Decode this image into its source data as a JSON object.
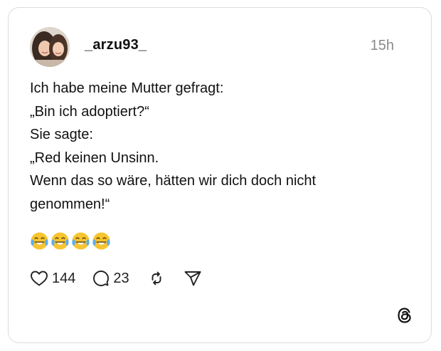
{
  "post": {
    "username": "_arzu93_",
    "timestamp": "15h",
    "text_lines": [
      "Ich habe meine Mutter gefragt:",
      "„Bin ich adoptiert?“",
      "Sie sagte:",
      "„Red keinen Unsinn.",
      "Wenn das so wäre, hätten wir dich doch nicht",
      "genommen!“"
    ],
    "emojis": [
      "face-with-tears-of-joy",
      "face-with-tears-of-joy",
      "face-with-tears-of-joy",
      "face-with-tears-of-joy"
    ]
  },
  "actions": {
    "like_count": "144",
    "reply_count": "23",
    "icons": [
      "heart-icon",
      "comment-icon",
      "repost-icon",
      "share-icon"
    ]
  },
  "brand": {
    "logo": "threads-logo-icon"
  },
  "colors": {
    "text": "#111111",
    "muted": "#8a8a8a",
    "border": "#dcdcdc",
    "emoji_face": "#f7c531"
  }
}
